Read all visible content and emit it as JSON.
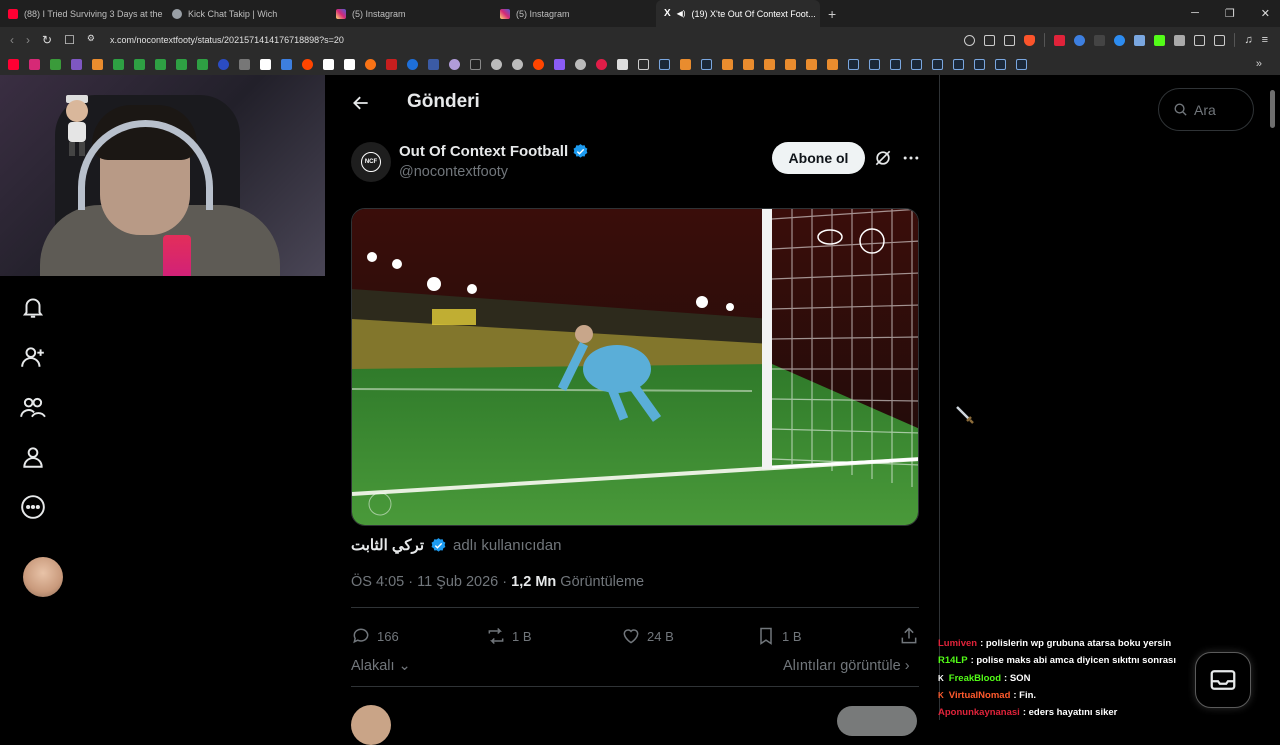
{
  "browser": {
    "tabs": [
      {
        "label": "(88) I Tried Surviving 3 Days at the S...",
        "icon": "youtube-icon",
        "color": "#ff0033"
      },
      {
        "label": "Kick Chat Takip | Wich",
        "icon": "globe-icon",
        "color": "#9aa0a6"
      },
      {
        "label": "(5) Instagram",
        "icon": "instagram-icon",
        "color": "#d62976"
      },
      {
        "label": "(5) Instagram",
        "icon": "instagram-icon",
        "color": "#d62976"
      },
      {
        "label": "(19) X'te Out Of Context Foot...",
        "icon": "x-icon",
        "color": "#ffffff",
        "active": true
      }
    ],
    "new_tab": "+",
    "url": "x.com/nocontextfooty/status/2021571414176718898?s=20"
  },
  "page": {
    "title": "Gönderi",
    "search_placeholder": "Ara"
  },
  "post": {
    "author_name": "Out Of Context Football",
    "author_handle": "@nocontextfooty",
    "author_logo": "NCF",
    "subscribe_label": "Abone ol",
    "attribution_name": "تركي الثابت",
    "attribution_suffix": "adlı kullanıcıdan",
    "timestamp": "ÖS 4:05 · 11 Şub 2026 · ",
    "views_value": "1,2 Mn",
    "views_label": " Görüntüleme",
    "replies": "166",
    "reposts": "1 B",
    "likes": "24 B",
    "bookmarks": "1 B",
    "relevant_label": "Alakalı",
    "quotes_label": "Alıntıları görüntüle"
  },
  "chat": [
    {
      "user": "Lumiven",
      "color": "#e0233a",
      "badge": "",
      "text": ": polislerin wp grubuna atarsa boku yersin"
    },
    {
      "user": "R14LP",
      "color": "#53fc18",
      "badge": "",
      "text": ": polise maks abi amca diyicen sıkıtnı sonrası"
    },
    {
      "user": "FreakBlood",
      "color": "#53fc18",
      "badge": "K",
      "text": ": SON"
    },
    {
      "user": "VirtualNomad",
      "color": "#ff5a2d",
      "badge": "K",
      "text": ": Fin."
    },
    {
      "user": "Aponunkaynanasi",
      "color": "#e0233a",
      "badge": "",
      "text": ": eders hayatını siker"
    }
  ],
  "colors": {
    "accent_blue": "#1d9bf0",
    "background": "#000000",
    "muted": "#71767b"
  }
}
